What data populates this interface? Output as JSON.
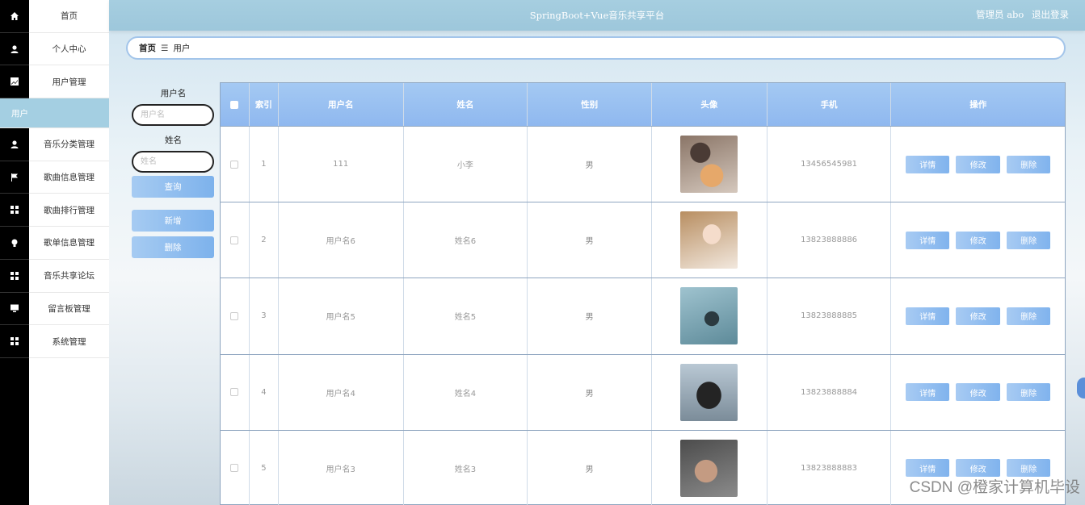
{
  "app": {
    "title": "SpringBoot+Vue音乐共享平台",
    "user_label": "管理员 abo",
    "logout_label": "退出登录"
  },
  "sidebar": {
    "items": [
      {
        "label": "首页",
        "icon": "home-icon"
      },
      {
        "label": "个人中心",
        "icon": "user-icon"
      },
      {
        "label": "用户管理",
        "icon": "chart-icon"
      },
      {
        "label": "用户",
        "icon": "",
        "active": true
      },
      {
        "label": "音乐分类管理",
        "icon": "user-icon"
      },
      {
        "label": "歌曲信息管理",
        "icon": "flag-icon"
      },
      {
        "label": "歌曲排行管理",
        "icon": "grid-icon"
      },
      {
        "label": "歌单信息管理",
        "icon": "bulb-icon"
      },
      {
        "label": "音乐共享论坛",
        "icon": "grid-icon"
      },
      {
        "label": "留言板管理",
        "icon": "monitor-icon"
      },
      {
        "label": "系统管理",
        "icon": "grid-icon"
      }
    ]
  },
  "breadcrumb": {
    "home": "首页",
    "separator": "☰",
    "current": "用户"
  },
  "search": {
    "username_label": "用户名",
    "username_placeholder": "用户名",
    "name_label": "姓名",
    "name_placeholder": "姓名",
    "query_button": "查询",
    "add_button": "新增",
    "delete_button": "删除"
  },
  "table": {
    "headers": {
      "index": "索引",
      "username": "用户名",
      "name": "姓名",
      "gender": "性别",
      "avatar": "头像",
      "phone": "手机",
      "actions": "操作"
    },
    "rows": [
      {
        "index": "1",
        "username": "111",
        "name": "小李",
        "gender": "男",
        "phone": "13456545981"
      },
      {
        "index": "2",
        "username": "用户名6",
        "name": "姓名6",
        "gender": "男",
        "phone": "13823888886"
      },
      {
        "index": "3",
        "username": "用户名5",
        "name": "姓名5",
        "gender": "男",
        "phone": "13823888885"
      },
      {
        "index": "4",
        "username": "用户名4",
        "name": "姓名4",
        "gender": "男",
        "phone": "13823888884"
      },
      {
        "index": "5",
        "username": "用户名3",
        "name": "姓名3",
        "gender": "男",
        "phone": "13823888883"
      }
    ],
    "row_actions": {
      "detail": "详情",
      "edit": "修改",
      "delete": "删除"
    }
  },
  "watermark": "CSDN @橙家计算机毕设",
  "colors": {
    "header_bg": "#a6cee0",
    "active_menu": "#a4cfe2",
    "button": "#8fb8ef",
    "sidebar_strip": "#000000"
  }
}
